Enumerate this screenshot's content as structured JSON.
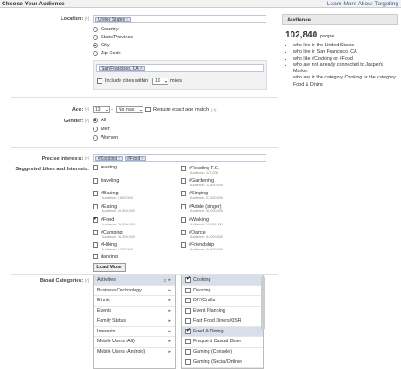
{
  "header": {
    "title": "Choose Your Audience",
    "link": "Learn More About Targeting"
  },
  "location": {
    "label": "Location:",
    "help": "[?]",
    "token": "United States",
    "options": [
      "Country",
      "State/Province",
      "City",
      "Zip Code"
    ],
    "selected": "City",
    "city_token": "San Francisco, CA",
    "include_label": "Include cities within",
    "radius": "10",
    "miles": "miles"
  },
  "age": {
    "label": "Age:",
    "help": "[?]",
    "min": "13",
    "dash": "-",
    "max": "No max",
    "exact_label": "Require exact age match",
    "exact_help": "[?]"
  },
  "gender": {
    "label": "Gender:",
    "help": "[?]",
    "options": [
      "All",
      "Men",
      "Women"
    ],
    "selected": "All"
  },
  "precise": {
    "label": "Precise Interests:",
    "help": "[?]",
    "tokens": [
      "#Cooking",
      "#Food"
    ]
  },
  "suggested": {
    "label": "Suggested Likes and Interests:",
    "left": [
      {
        "name": "reading",
        "aud": "",
        "checked": false
      },
      {
        "name": "traveling",
        "aud": "",
        "checked": false
      },
      {
        "name": "#Baking",
        "aud": "Audience: 9,800,000",
        "checked": false
      },
      {
        "name": "#Eating",
        "aud": "Audience: 29,500,000",
        "checked": false
      },
      {
        "name": "#Food",
        "aud": "Audience: 29,500,000",
        "checked": true
      },
      {
        "name": "#Camping",
        "aud": "Audience: 16,300,000",
        "checked": false
      },
      {
        "name": "#Hiking",
        "aud": "Audience: 9,200,000",
        "checked": false
      },
      {
        "name": "dancing",
        "aud": "",
        "checked": false
      }
    ],
    "right": [
      {
        "name": "#Reading F.C.",
        "aud": "Audience: 127,000",
        "checked": false
      },
      {
        "name": "#Gardening",
        "aud": "Audience: 12,600,000",
        "checked": false
      },
      {
        "name": "#Singing",
        "aud": "Audience: 23,500,000",
        "checked": false
      },
      {
        "name": "#Adele (singer)",
        "aud": "Audience: 30,000,000",
        "checked": false
      },
      {
        "name": "#Walking",
        "aud": "Audience: 11,000,000",
        "checked": false
      },
      {
        "name": "#Dance",
        "aud": "Audience: 44,000,000",
        "checked": false
      },
      {
        "name": "#Friendship",
        "aud": "Audience: 48,600,000",
        "checked": false
      }
    ],
    "load_more": "Load More"
  },
  "broad": {
    "label": "Broad Categories:",
    "help": "[?]",
    "categories": [
      {
        "name": "Activities",
        "count": "2",
        "highlight": true
      },
      {
        "name": "Business/Technology",
        "count": "",
        "highlight": false
      },
      {
        "name": "Ethnic",
        "count": "",
        "highlight": false
      },
      {
        "name": "Events",
        "count": "",
        "highlight": false
      },
      {
        "name": "Family Status",
        "count": "",
        "highlight": false
      },
      {
        "name": "Interests",
        "count": "",
        "highlight": false
      },
      {
        "name": "Mobile Users (All)",
        "count": "",
        "highlight": false
      },
      {
        "name": "Mobile Users (Android)",
        "count": "",
        "highlight": false
      }
    ],
    "subcategories": [
      {
        "name": "Cooking",
        "checked": true,
        "highlight": true
      },
      {
        "name": "Dancing",
        "checked": false,
        "highlight": false
      },
      {
        "name": "DIY/Crafts",
        "checked": false,
        "highlight": false
      },
      {
        "name": "Event Planning",
        "checked": false,
        "highlight": false
      },
      {
        "name": "Fast Food Diners/QSR",
        "checked": false,
        "highlight": false
      },
      {
        "name": "Food & Dining",
        "checked": true,
        "highlight": true
      },
      {
        "name": "Frequent Casual Diner",
        "checked": false,
        "highlight": false
      },
      {
        "name": "Gaming (Console)",
        "checked": false,
        "highlight": false
      },
      {
        "name": "Gaming (Social/Online)",
        "checked": false,
        "highlight": false
      }
    ]
  },
  "audience": {
    "title": "Audience",
    "count": "102,840",
    "unit": "people",
    "bullets": [
      "who live in the United States",
      "who live in San Francisco, CA",
      "who like #Cooking or #Food",
      "who are not already connected to Jasper's Market",
      "who are in the category Cooking or the category Food & Dining"
    ]
  }
}
